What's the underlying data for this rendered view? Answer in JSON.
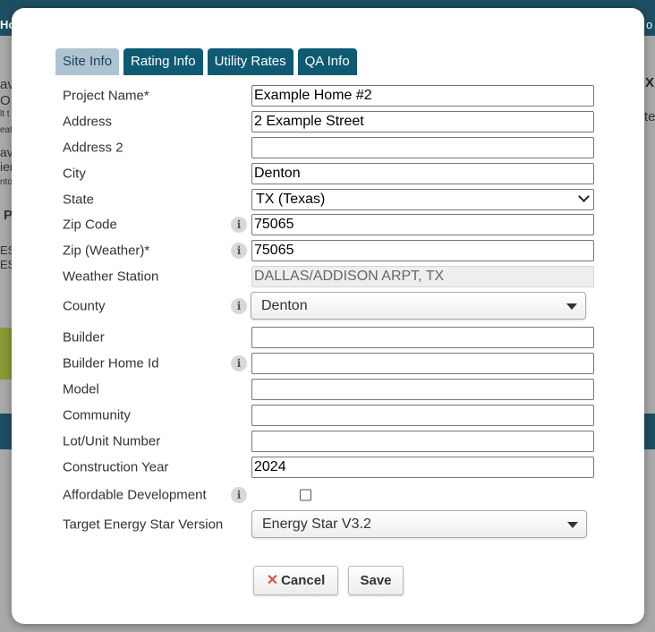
{
  "background": {
    "topbar_left": "Ho",
    "topbar_right": "o",
    "left_fragments": [
      "av",
      "O",
      "lt t",
      "eat",
      "avi",
      "ien",
      "nto",
      "P",
      "ES",
      "ES"
    ],
    "right_x": "X",
    "right_text": "te"
  },
  "tabs": [
    {
      "label": "Site Info",
      "active": true
    },
    {
      "label": "Rating Info",
      "active": false
    },
    {
      "label": "Utility Rates",
      "active": false
    },
    {
      "label": "QA Info",
      "active": false
    }
  ],
  "form": {
    "project_name": {
      "label": "Project Name*",
      "value": "Example Home #2"
    },
    "address": {
      "label": "Address",
      "value": "2 Example Street"
    },
    "address2": {
      "label": "Address 2",
      "value": ""
    },
    "city": {
      "label": "City",
      "value": "Denton"
    },
    "state": {
      "label": "State",
      "value": "TX (Texas)"
    },
    "zip_code": {
      "label": "Zip Code",
      "value": "75065"
    },
    "zip_weather": {
      "label": "Zip (Weather)*",
      "value": "75065"
    },
    "weather_station": {
      "label": "Weather Station",
      "value": "DALLAS/ADDISON ARPT, TX"
    },
    "county": {
      "label": "County",
      "value": "Denton"
    },
    "builder": {
      "label": "Builder",
      "value": ""
    },
    "builder_home_id": {
      "label": "Builder Home Id",
      "value": ""
    },
    "model": {
      "label": "Model",
      "value": ""
    },
    "community": {
      "label": "Community",
      "value": ""
    },
    "lot_unit": {
      "label": "Lot/Unit Number",
      "value": ""
    },
    "construction_year": {
      "label": "Construction Year",
      "value": "2024"
    },
    "affordable": {
      "label": "Affordable Development",
      "checked": false
    },
    "energy_star": {
      "label": "Target Energy Star Version",
      "value": "Energy Star V3.2"
    }
  },
  "info_glyph": "i",
  "buttons": {
    "cancel_icon": "✕",
    "cancel": "Cancel",
    "save": "Save"
  },
  "colors": {
    "tab_bg": "#0e5a73",
    "tab_active_bg": "#aec3d2",
    "cancel_icon": "#d9534f"
  }
}
